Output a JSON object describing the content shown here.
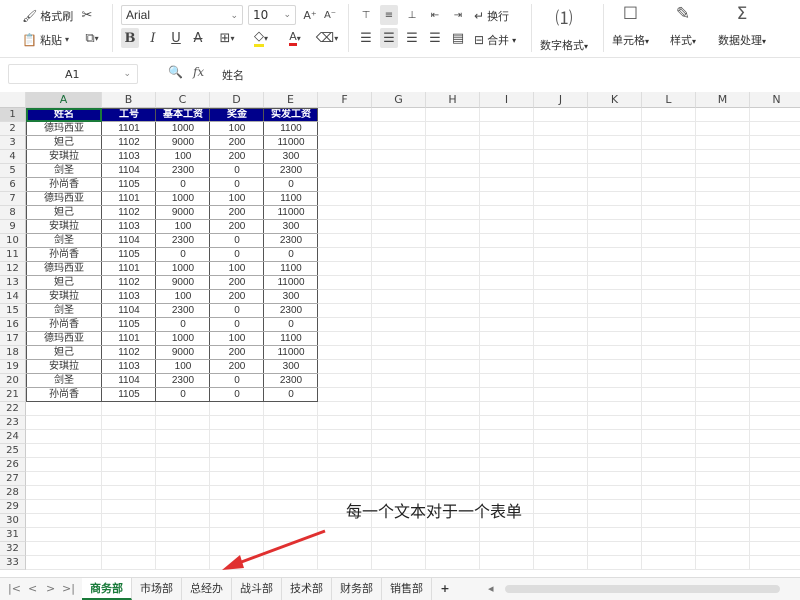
{
  "ribbon": {
    "format_painter": "格式刷",
    "paste": "粘贴",
    "font_name": "Arial",
    "font_size": "10",
    "wrap": "换行",
    "merge": "合并",
    "number_format": "数字格式",
    "cell": "单元格",
    "style": "样式",
    "data_process": "数据处理"
  },
  "formula_bar": {
    "cell_ref": "A1",
    "value": "姓名"
  },
  "columns": [
    "A",
    "B",
    "C",
    "D",
    "E",
    "F",
    "G",
    "H",
    "I",
    "J",
    "K",
    "L",
    "M",
    "N"
  ],
  "table": {
    "headers": [
      "姓名",
      "工号",
      "基本工资",
      "奖金",
      "实发工资"
    ],
    "rows": [
      [
        "德玛西亚",
        "1101",
        "1000",
        "100",
        "1100"
      ],
      [
        "妲己",
        "1102",
        "9000",
        "200",
        "11000"
      ],
      [
        "安琪拉",
        "1103",
        "100",
        "200",
        "300"
      ],
      [
        "剑圣",
        "1104",
        "2300",
        "0",
        "2300"
      ],
      [
        "孙尚香",
        "1105",
        "0",
        "0",
        "0"
      ],
      [
        "德玛西亚",
        "1101",
        "1000",
        "100",
        "1100"
      ],
      [
        "妲己",
        "1102",
        "9000",
        "200",
        "11000"
      ],
      [
        "安琪拉",
        "1103",
        "100",
        "200",
        "300"
      ],
      [
        "剑圣",
        "1104",
        "2300",
        "0",
        "2300"
      ],
      [
        "孙尚香",
        "1105",
        "0",
        "0",
        "0"
      ],
      [
        "德玛西亚",
        "1101",
        "1000",
        "100",
        "1100"
      ],
      [
        "妲己",
        "1102",
        "9000",
        "200",
        "11000"
      ],
      [
        "安琪拉",
        "1103",
        "100",
        "200",
        "300"
      ],
      [
        "剑圣",
        "1104",
        "2300",
        "0",
        "2300"
      ],
      [
        "孙尚香",
        "1105",
        "0",
        "0",
        "0"
      ],
      [
        "德玛西亚",
        "1101",
        "1000",
        "100",
        "1100"
      ],
      [
        "妲己",
        "1102",
        "9000",
        "200",
        "11000"
      ],
      [
        "安琪拉",
        "1103",
        "100",
        "200",
        "300"
      ],
      [
        "剑圣",
        "1104",
        "2300",
        "0",
        "2300"
      ],
      [
        "孙尚香",
        "1105",
        "0",
        "0",
        "0"
      ]
    ]
  },
  "row_count": 33,
  "sheets": [
    "商务部",
    "市场部",
    "总经办",
    "战斗部",
    "技术部",
    "财务部",
    "销售部"
  ],
  "active_sheet": "商务部",
  "add_sheet": "+",
  "annotation": "每一个文本对于一个表单",
  "colors": {
    "header_bg": "#00008b",
    "accent": "#1a7a3a",
    "arrow": "#e03030"
  }
}
